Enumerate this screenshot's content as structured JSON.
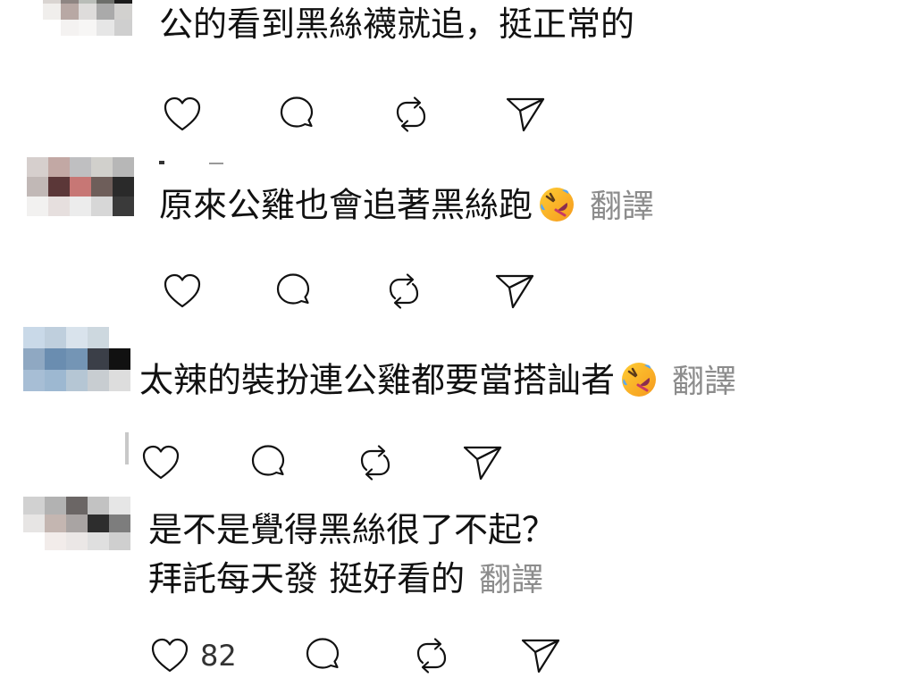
{
  "comments": [
    {
      "text": "公的看到黑絲襪就追，挺正常的",
      "translate": "",
      "likes": "",
      "avatar_colors": [
        "#d9d4d1",
        "#8e8582",
        "#b9bdb8",
        "#6c6e6a",
        "#1b1b1b",
        "#f0eeec",
        "#b8a8a4",
        "#dedcdb",
        "#aaaaaa",
        "#d2d1cf",
        "#ffffff",
        "#f4f2f1",
        "#f7f6f5",
        "#e6e6e6",
        "#cfcfcf"
      ]
    },
    {
      "text": "原來公雞也會追著黑絲跑",
      "translate": "翻譯",
      "likes": "",
      "avatar_colors": [
        "#d6cfcd",
        "#c2a8a4",
        "#bfbfc1",
        "#d1d0cc",
        "#b7b7b7",
        "#c1b8b6",
        "#5b3738",
        "#c77775",
        "#6e5e5a",
        "#2a2a2a",
        "#f2f1f0",
        "#e6dfde",
        "#ececec",
        "#d7d7d7",
        "#3a3a3a"
      ]
    },
    {
      "text": "太辣的裝扮連公雞都要當搭訕者",
      "translate": "翻譯",
      "likes": "",
      "avatar_colors": [
        "#c9d9e8",
        "#bfcfdd",
        "#d9e3ec",
        "#cdd8df",
        "#ffffff",
        "#8fa8c2",
        "#6a8db0",
        "#7495b5",
        "#3b3f48",
        "#111111",
        "#a7bed5",
        "#9db8d1",
        "#b5c6d4",
        "#c8cdd1",
        "#dddddd"
      ]
    },
    {
      "text": "是不是覺得黑絲很了不起？",
      "text_line2": "拜託每天發 挺好看的",
      "translate": "翻譯",
      "likes": "82",
      "avatar_colors": [
        "#d1d1d1",
        "#b2b2b2",
        "#6b6665",
        "#c2c2c2",
        "#e6e6e6",
        "#e7e5e4",
        "#c4b6b1",
        "#a9a4a3",
        "#2d2d2d",
        "#7d7d7d",
        "#ffffff",
        "#f2ecea",
        "#ebe7e6",
        "#dfdfdf",
        "#cfcfcf"
      ]
    }
  ],
  "icons": {
    "like": "heart-icon",
    "reply": "speech-bubble-icon",
    "repost": "repost-icon",
    "share": "paper-plane-icon",
    "emoji": "rolling-on-floor-laughing-emoji"
  }
}
